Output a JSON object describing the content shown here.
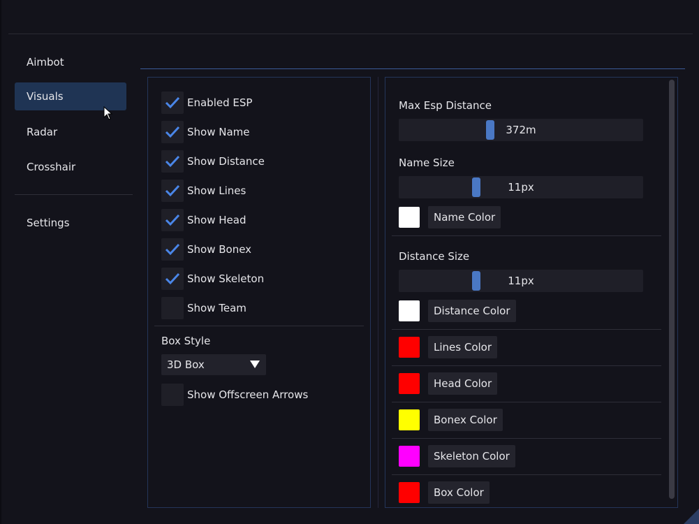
{
  "sidebar": {
    "items": [
      {
        "label": "Aimbot"
      },
      {
        "label": "Visuals"
      },
      {
        "label": "Radar"
      },
      {
        "label": "Crosshair"
      },
      {
        "label": "Settings"
      }
    ],
    "active": "Visuals"
  },
  "esp": {
    "checkboxes": [
      {
        "label": "Enabled ESP",
        "checked": true
      },
      {
        "label": "Show Name",
        "checked": true
      },
      {
        "label": "Show Distance",
        "checked": true
      },
      {
        "label": "Show Lines",
        "checked": true
      },
      {
        "label": "Show Head",
        "checked": true
      },
      {
        "label": "Show Bonex",
        "checked": true
      },
      {
        "label": "Show Skeleton",
        "checked": true
      },
      {
        "label": "Show Team",
        "checked": false
      }
    ],
    "box_style_label": "Box Style",
    "box_style_value": "3D Box",
    "offscreen_arrows": {
      "label": "Show Offscreen Arrows",
      "checked": false
    }
  },
  "settings": {
    "max_distance": {
      "label": "Max Esp Distance",
      "value": "372m",
      "fraction": 0.37
    },
    "name_size": {
      "label": "Name Size",
      "value": "11px",
      "fraction": 0.31
    },
    "name_color": {
      "label": "Name Color",
      "color": "#ffffff"
    },
    "distance_size": {
      "label": "Distance Size",
      "value": "11px",
      "fraction": 0.31
    },
    "distance_color": {
      "label": "Distance Color",
      "color": "#ffffff"
    },
    "lines_color": {
      "label": "Lines Color",
      "color": "#ff0000"
    },
    "head_color": {
      "label": "Head Color",
      "color": "#ff0000"
    },
    "bonex_color": {
      "label": "Bonex Color",
      "color": "#ffff00"
    },
    "skeleton_color": {
      "label": "Skeleton Color",
      "color": "#ff00ff"
    },
    "box_color": {
      "label": "Box Color",
      "color": "#ff0000"
    }
  },
  "theme": {
    "accent": "#4a78c4",
    "active_bg": "#1f3454"
  }
}
